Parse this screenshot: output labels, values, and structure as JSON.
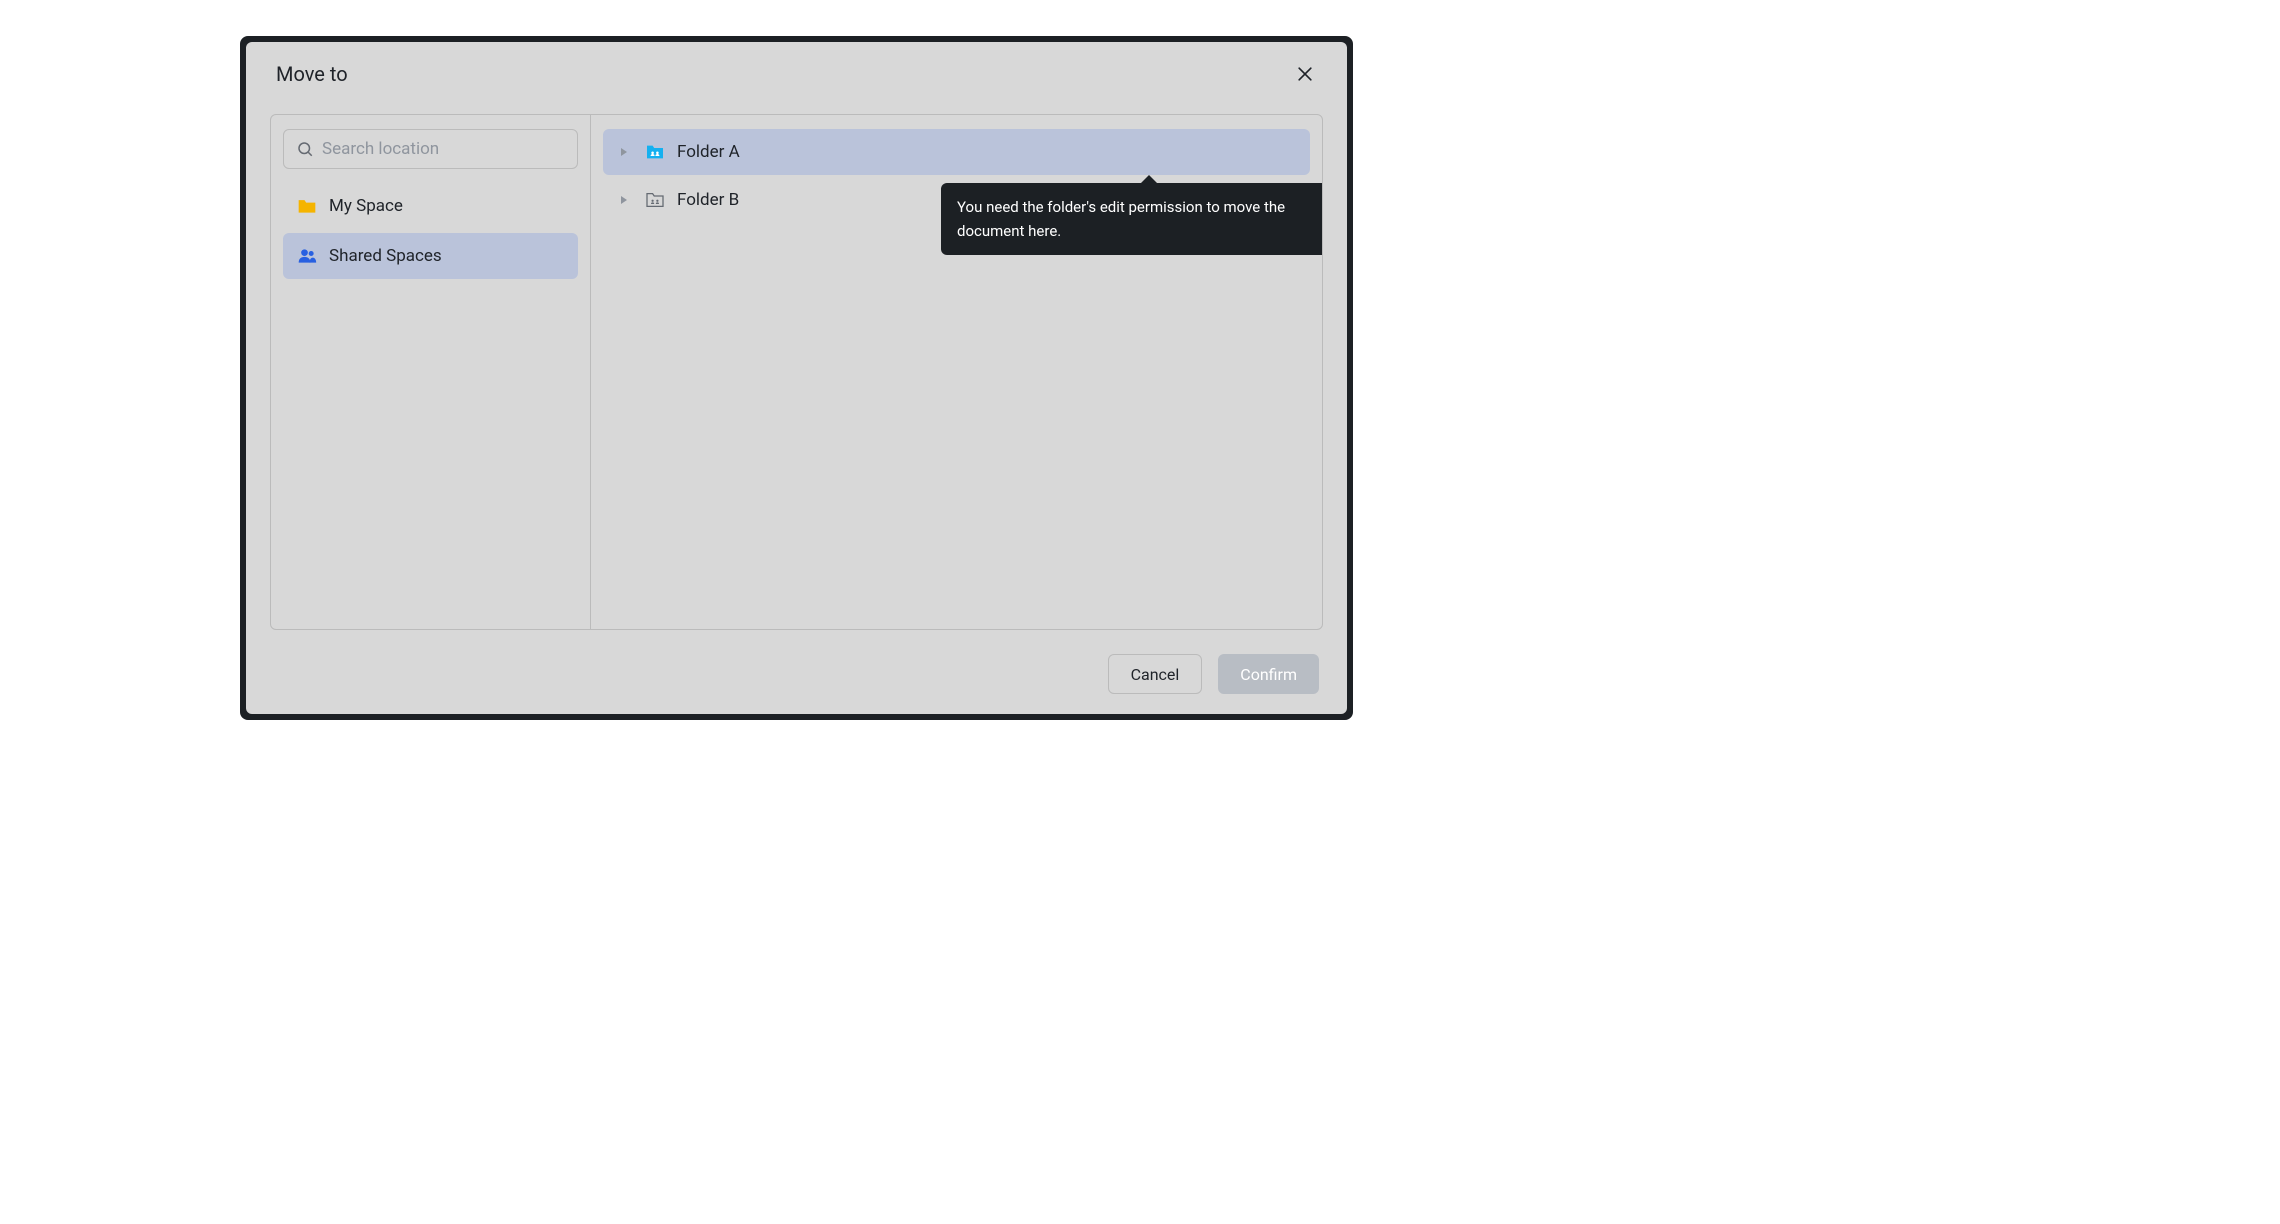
{
  "dialog": {
    "title": "Move to"
  },
  "search": {
    "placeholder": "Search location",
    "value": ""
  },
  "sidebar": {
    "items": [
      {
        "label": "My Space",
        "active": false
      },
      {
        "label": "Shared Spaces",
        "active": true
      }
    ]
  },
  "folders": [
    {
      "label": "Folder A",
      "selected": true,
      "type": "shared"
    },
    {
      "label": "Folder B",
      "selected": false,
      "type": "shared-outline"
    }
  ],
  "tooltip": {
    "text": "You need the folder's edit permission to move the document here."
  },
  "footer": {
    "cancel_label": "Cancel",
    "confirm_label": "Confirm"
  }
}
